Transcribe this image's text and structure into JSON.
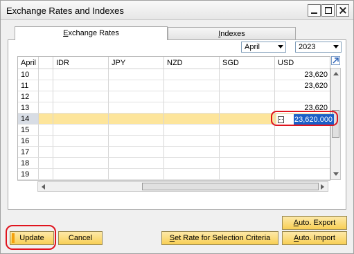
{
  "window": {
    "title": "Exchange Rates and Indexes"
  },
  "tabs": {
    "exchange_rates": {
      "pre": "",
      "u": "E",
      "post": "xchange Rates"
    },
    "indexes": {
      "pre": "",
      "u": "I",
      "post": "ndexes"
    }
  },
  "filters": {
    "month": "April",
    "year": "2023"
  },
  "grid": {
    "columns": [
      "April",
      "IDR",
      "JPY",
      "NZD",
      "SGD",
      "USD"
    ],
    "rows": [
      {
        "day": "10",
        "usd": "23,620"
      },
      {
        "day": "11",
        "usd": "23,620"
      },
      {
        "day": "12",
        "usd": ""
      },
      {
        "day": "13",
        "usd": "23,620"
      },
      {
        "day": "14",
        "usd": ""
      },
      {
        "day": "15",
        "usd": ""
      },
      {
        "day": "16",
        "usd": ""
      },
      {
        "day": "17",
        "usd": ""
      },
      {
        "day": "18",
        "usd": ""
      },
      {
        "day": "19",
        "usd": ""
      }
    ],
    "selected_day": "14",
    "edit_value": "23,620.000"
  },
  "buttons": {
    "update": "Update",
    "cancel": "Cancel",
    "set_rate": {
      "pre": "",
      "u": "S",
      "post": "et Rate for Selection Criteria"
    },
    "auto_import": {
      "pre": "",
      "u": "A",
      "post": "uto. Import"
    },
    "auto_export": {
      "pre": "",
      "u": "A",
      "post": "uto. Export"
    }
  },
  "icons": {
    "expand": "expand-arrow-icon",
    "calculator": "calculator-icon"
  },
  "colors": {
    "button": "#f8cf55",
    "selected_row": "#fde59b",
    "edit_highlight": "#1a5fc8",
    "annotation": "#e0141e"
  }
}
